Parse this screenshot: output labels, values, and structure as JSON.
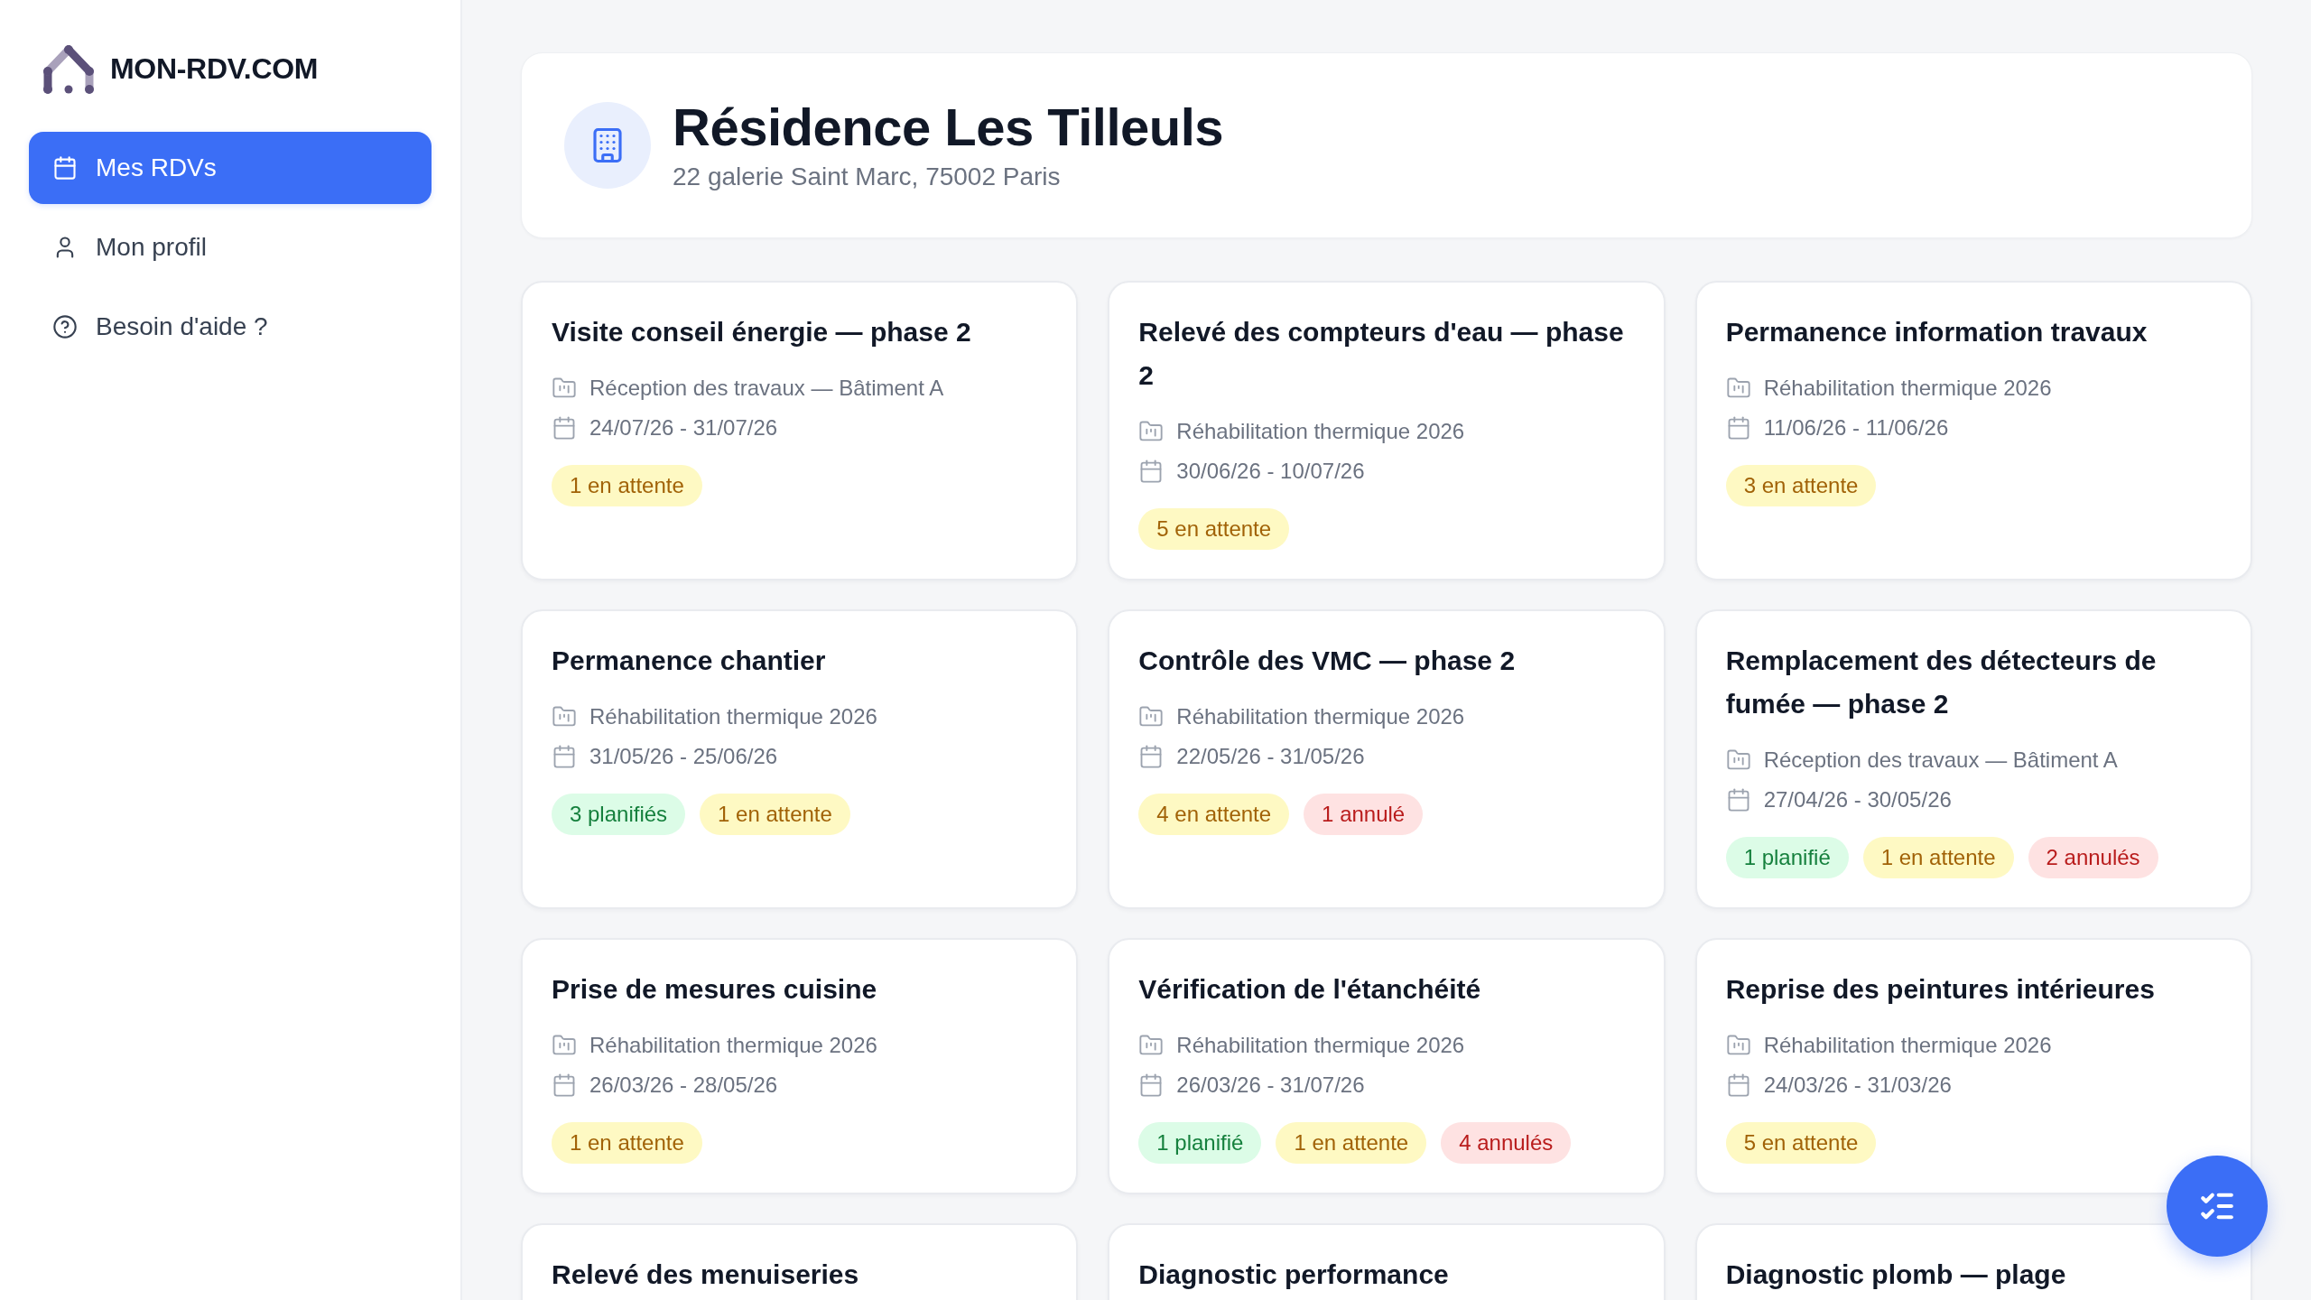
{
  "sidebar": {
    "brand": "MON-RDV.COM",
    "items": [
      {
        "label": "Mes RDVs",
        "selected": true
      },
      {
        "label": "Mon profil",
        "selected": false
      },
      {
        "label": "Besoin d'aide ?",
        "selected": false
      }
    ]
  },
  "residence": {
    "name": "Résidence Les Tilleuls",
    "address": "22 galerie Saint Marc, 75002 Paris"
  },
  "appointments": [
    {
      "title": "Visite conseil énergie — phase 2",
      "project": "Réception des travaux — Bâtiment A",
      "dates": "24/07/26 - 31/07/26",
      "counts": [
        {
          "kind": "pending",
          "label": "1 en attente"
        }
      ]
    },
    {
      "title": "Relevé des compteurs d'eau — phase 2",
      "project": "Réhabilitation thermique 2026",
      "dates": "30/06/26 - 10/07/26",
      "counts": [
        {
          "kind": "pending",
          "label": "5 en attente"
        }
      ]
    },
    {
      "title": "Permanence information travaux",
      "project": "Réhabilitation thermique 2026",
      "dates": "11/06/26 - 11/06/26",
      "counts": [
        {
          "kind": "pending",
          "label": "3 en attente"
        }
      ]
    },
    {
      "title": "Permanence chantier",
      "project": "Réhabilitation thermique 2026",
      "dates": "31/05/26 - 25/06/26",
      "counts": [
        {
          "kind": "planned",
          "label": "3 planifiés"
        },
        {
          "kind": "pending",
          "label": "1 en attente"
        }
      ]
    },
    {
      "title": "Contrôle des VMC — phase 2",
      "project": "Réhabilitation thermique 2026",
      "dates": "22/05/26 - 31/05/26",
      "counts": [
        {
          "kind": "pending",
          "label": "4 en attente"
        },
        {
          "kind": "cancelled",
          "label": "1 annulé"
        }
      ]
    },
    {
      "title": "Remplacement des détecteurs de fumée — phase 2",
      "project": "Réception des travaux — Bâtiment A",
      "dates": "27/04/26 - 30/05/26",
      "counts": [
        {
          "kind": "planned",
          "label": "1 planifié"
        },
        {
          "kind": "pending",
          "label": "1 en attente"
        },
        {
          "kind": "cancelled",
          "label": "2 annulés"
        }
      ]
    },
    {
      "title": "Prise de mesures cuisine",
      "project": "Réhabilitation thermique 2026",
      "dates": "26/03/26 - 28/05/26",
      "counts": [
        {
          "kind": "pending",
          "label": "1 en attente"
        }
      ]
    },
    {
      "title": "Vérification de l'étanchéité",
      "project": "Réhabilitation thermique 2026",
      "dates": "26/03/26 - 31/07/26",
      "counts": [
        {
          "kind": "planned",
          "label": "1 planifié"
        },
        {
          "kind": "pending",
          "label": "1 en attente"
        },
        {
          "kind": "cancelled",
          "label": "4 annulés"
        }
      ]
    },
    {
      "title": "Reprise des peintures intérieures",
      "project": "Réhabilitation thermique 2026",
      "dates": "24/03/26 - 31/03/26",
      "counts": [
        {
          "kind": "pending",
          "label": "5 en attente"
        }
      ]
    },
    {
      "title": "Relevé des menuiseries"
    },
    {
      "title": "Diagnostic performance"
    },
    {
      "title": "Diagnostic plomb — plage"
    }
  ]
}
